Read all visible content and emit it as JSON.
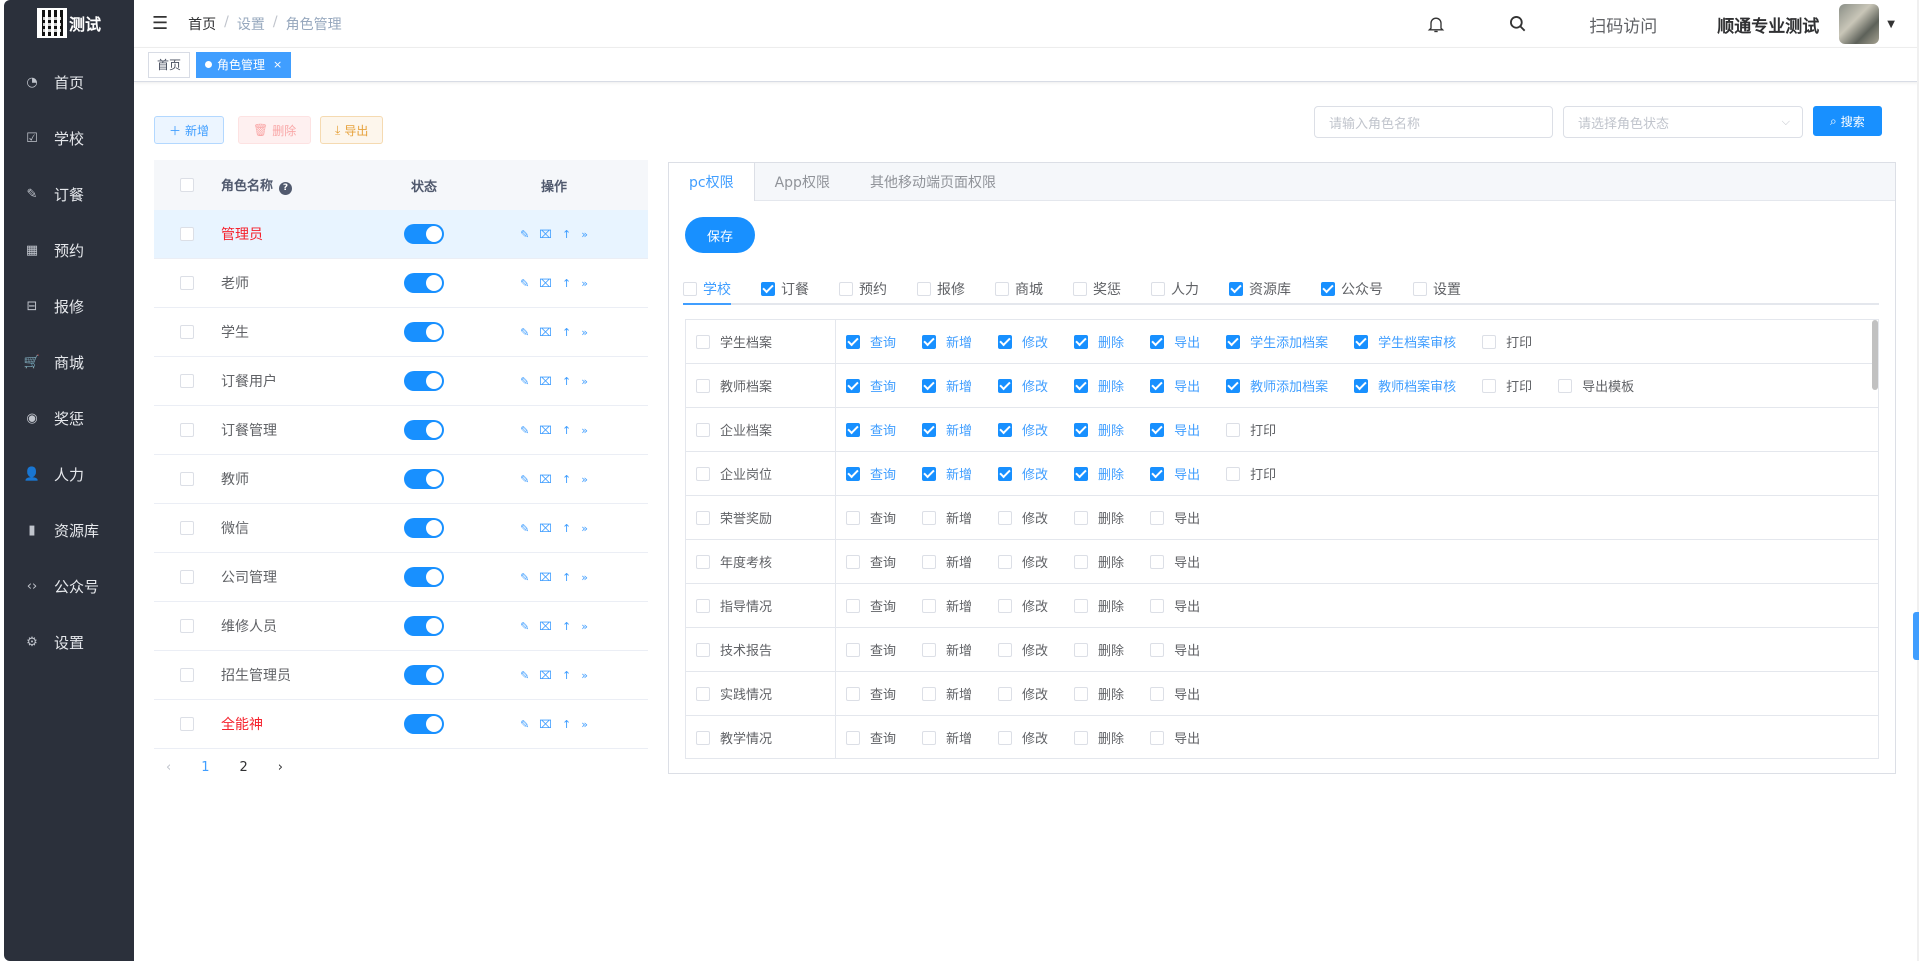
{
  "sidebar": {
    "logo_text": "测试",
    "items": [
      {
        "label": "首页",
        "icon": "dashboard-icon"
      },
      {
        "label": "学校",
        "icon": "checkbox-icon"
      },
      {
        "label": "订餐",
        "icon": "edit-icon"
      },
      {
        "label": "预约",
        "icon": "calendar-icon"
      },
      {
        "label": "报修",
        "icon": "toolbox-icon"
      },
      {
        "label": "商城",
        "icon": "cart-icon"
      },
      {
        "label": "奖惩",
        "icon": "eye-icon"
      },
      {
        "label": "人力",
        "icon": "user-icon"
      },
      {
        "label": "资源库",
        "icon": "bar-chart-icon"
      },
      {
        "label": "公众号",
        "icon": "code-icon"
      },
      {
        "label": "设置",
        "icon": "settings-icon"
      }
    ]
  },
  "header": {
    "breadcrumb": [
      "首页",
      "设置",
      "角色管理"
    ],
    "scan_label": "扫码访问",
    "username": "顺通专业测试"
  },
  "tags": {
    "home": "首页",
    "active": "角色管理",
    "close": "×"
  },
  "toolbar": {
    "add": "新增",
    "delete": "删除",
    "export": "导出",
    "name_placeholder": "请输入角色名称",
    "status_placeholder": "请选择角色状态",
    "search": "搜索"
  },
  "role_table": {
    "headers": {
      "name": "角色名称",
      "state": "状态",
      "ops": "操作"
    },
    "rows": [
      {
        "name": "管理员",
        "red": true
      },
      {
        "name": "老师",
        "red": false
      },
      {
        "name": "学生",
        "red": false
      },
      {
        "name": "订餐用户",
        "red": false
      },
      {
        "name": "订餐管理",
        "red": false
      },
      {
        "name": "教师",
        "red": false
      },
      {
        "name": "微信",
        "red": false
      },
      {
        "name": "公司管理",
        "red": false
      },
      {
        "name": "维修人员",
        "red": false
      },
      {
        "name": "招生管理员",
        "red": false
      },
      {
        "name": "全能神",
        "red": true
      }
    ],
    "pages": [
      "1",
      "2"
    ]
  },
  "panel": {
    "tabs": [
      "pc权限",
      "App权限",
      "其他移动端页面权限"
    ],
    "save": "保存",
    "modules": [
      {
        "label": "学校",
        "checked": false,
        "active": true
      },
      {
        "label": "订餐",
        "checked": true
      },
      {
        "label": "预约",
        "checked": false
      },
      {
        "label": "报修",
        "checked": false
      },
      {
        "label": "商城",
        "checked": false
      },
      {
        "label": "奖惩",
        "checked": false
      },
      {
        "label": "人力",
        "checked": false
      },
      {
        "label": "资源库",
        "checked": true
      },
      {
        "label": "公众号",
        "checked": true
      },
      {
        "label": "设置",
        "checked": false
      }
    ],
    "rows": [
      {
        "name": "学生档案",
        "acts": [
          [
            "查询",
            1
          ],
          [
            "新增",
            1
          ],
          [
            "修改",
            1
          ],
          [
            "删除",
            1
          ],
          [
            "导出",
            1
          ],
          [
            "学生添加档案",
            1
          ],
          [
            "学生档案审核",
            1
          ],
          [
            "打印",
            0
          ]
        ]
      },
      {
        "name": "教师档案",
        "acts": [
          [
            "查询",
            1
          ],
          [
            "新增",
            1
          ],
          [
            "修改",
            1
          ],
          [
            "删除",
            1
          ],
          [
            "导出",
            1
          ],
          [
            "教师添加档案",
            1
          ],
          [
            "教师档案审核",
            1
          ],
          [
            "打印",
            0
          ],
          [
            "导出模板",
            0
          ]
        ]
      },
      {
        "name": "企业档案",
        "acts": [
          [
            "查询",
            1
          ],
          [
            "新增",
            1
          ],
          [
            "修改",
            1
          ],
          [
            "删除",
            1
          ],
          [
            "导出",
            1
          ],
          [
            "打印",
            0
          ]
        ]
      },
      {
        "name": "企业岗位",
        "acts": [
          [
            "查询",
            1
          ],
          [
            "新增",
            1
          ],
          [
            "修改",
            1
          ],
          [
            "删除",
            1
          ],
          [
            "导出",
            1
          ],
          [
            "打印",
            0
          ]
        ]
      },
      {
        "name": "荣誉奖励",
        "acts": [
          [
            "查询",
            0
          ],
          [
            "新增",
            0
          ],
          [
            "修改",
            0
          ],
          [
            "删除",
            0
          ],
          [
            "导出",
            0
          ]
        ]
      },
      {
        "name": "年度考核",
        "acts": [
          [
            "查询",
            0
          ],
          [
            "新增",
            0
          ],
          [
            "修改",
            0
          ],
          [
            "删除",
            0
          ],
          [
            "导出",
            0
          ]
        ]
      },
      {
        "name": "指导情况",
        "acts": [
          [
            "查询",
            0
          ],
          [
            "新增",
            0
          ],
          [
            "修改",
            0
          ],
          [
            "删除",
            0
          ],
          [
            "导出",
            0
          ]
        ]
      },
      {
        "name": "技术报告",
        "acts": [
          [
            "查询",
            0
          ],
          [
            "新增",
            0
          ],
          [
            "修改",
            0
          ],
          [
            "删除",
            0
          ],
          [
            "导出",
            0
          ]
        ]
      },
      {
        "name": "实践情况",
        "acts": [
          [
            "查询",
            0
          ],
          [
            "新增",
            0
          ],
          [
            "修改",
            0
          ],
          [
            "删除",
            0
          ],
          [
            "导出",
            0
          ]
        ]
      },
      {
        "name": "教学情况",
        "acts": [
          [
            "查询",
            0
          ],
          [
            "新增",
            0
          ],
          [
            "修改",
            0
          ],
          [
            "删除",
            0
          ],
          [
            "导出",
            0
          ]
        ]
      }
    ]
  }
}
